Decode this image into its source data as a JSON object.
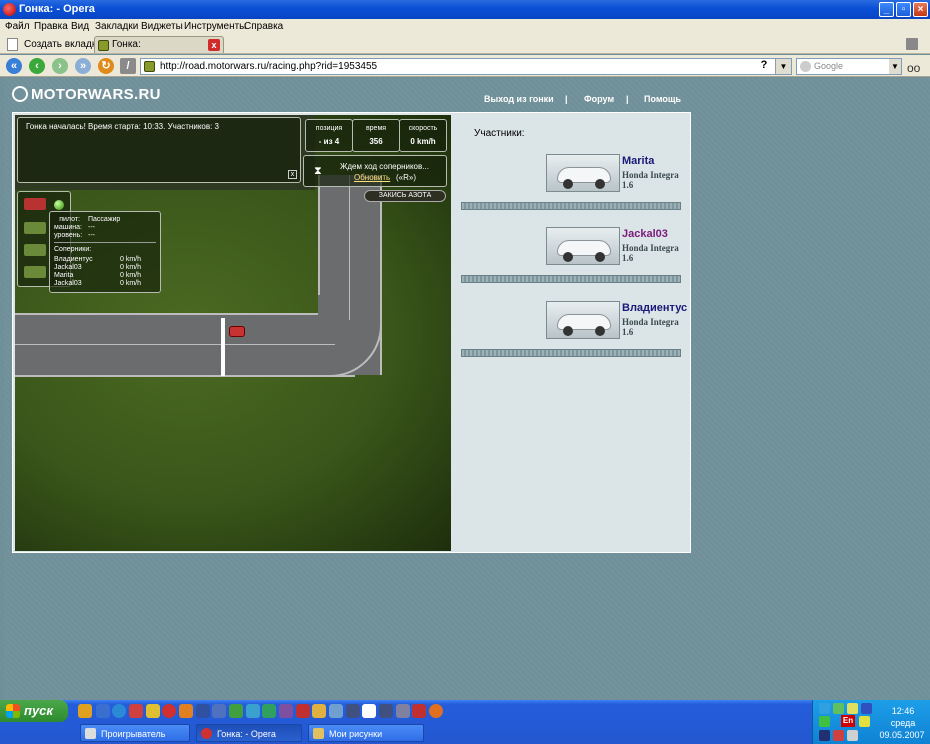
{
  "window": {
    "title": "Гонка: - Opera"
  },
  "menu": [
    "Файл",
    "Правка",
    "Вид",
    "Закладки",
    "Виджеты",
    "Инструменты",
    "Справка"
  ],
  "tabs": {
    "new_tab": "Создать вкладку",
    "active_tab": "Гонка:"
  },
  "address": {
    "url": "http://road.motorwars.ru/racing.php?rid=1953455",
    "search_placeholder": "Google"
  },
  "site": {
    "logo": "MOTORWARS.RU",
    "nav": [
      "Выход из гонки",
      "|",
      "Форум",
      "|",
      "Помощь"
    ]
  },
  "game": {
    "chat_message": "Гонка началась! Время старта: 10:33. Участников: 3",
    "close_glyph": "x",
    "stats": [
      {
        "label": "позиция",
        "value": "- из 4"
      },
      {
        "label": "время",
        "value": "356"
      },
      {
        "label": "скорость",
        "value": "0 km/h"
      }
    ],
    "waiting": "Ждем ход соперников...",
    "refresh": "Обновить",
    "refresh_key": "(«R»)",
    "nitro_button": "ЗАКИСЬ АЗОТА",
    "info": {
      "pilot_label": "пилот:",
      "pilot_value": "Пассажир",
      "car_label": "машина:",
      "car_value": "---",
      "level_label": "уровень:",
      "level_value": "---",
      "rivals_label": "Соперники:",
      "rivals": [
        {
          "name": "Владиентус",
          "speed": "0 km/h"
        },
        {
          "name": "Jackal03",
          "speed": "0 km/h"
        },
        {
          "name": "Marita",
          "speed": "0 km/h"
        },
        {
          "name": "Jackal03",
          "speed": "0 km/h"
        }
      ]
    }
  },
  "participants": {
    "title": "Участники:",
    "list": [
      {
        "name": "Marita",
        "car": "Honda Integra 1.6",
        "color": "#1a1a7a"
      },
      {
        "name": "Jackal03",
        "car": "Honda Integra 1.6",
        "color": "#7a1a7a"
      },
      {
        "name": "Владиентус",
        "car": "Honda Integra 1.6",
        "color": "#1a1a7a"
      }
    ]
  },
  "taskbar": {
    "start": "пуск",
    "tasks": [
      "Проигрыватель Win...",
      "Гонка: - Opera",
      "Мои рисунки"
    ],
    "lang": "En",
    "time": "12:46",
    "day": "среда",
    "date": "09.05.2007"
  }
}
